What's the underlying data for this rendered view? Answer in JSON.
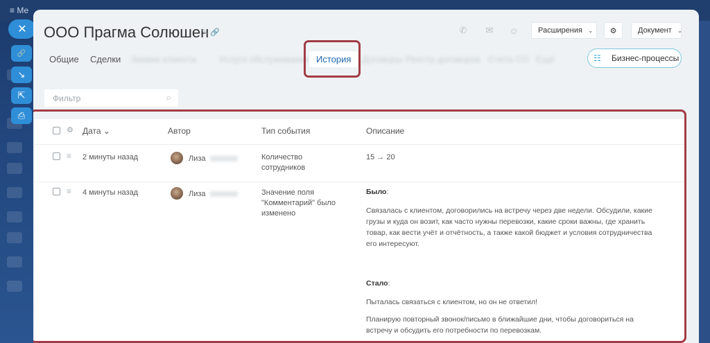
{
  "background": {
    "menu_label": "≡  Ме"
  },
  "quick_actions": [
    {
      "icon": "close-icon",
      "glyph": "✕"
    },
    {
      "icon": "link-icon",
      "glyph": "🔗"
    },
    {
      "icon": "arrow-icon",
      "glyph": "↘"
    },
    {
      "icon": "external-icon",
      "glyph": "⇱"
    },
    {
      "icon": "printer-icon",
      "glyph": "⎙"
    }
  ],
  "header": {
    "title": "ООО Прагма Солюшен",
    "title_icons": "✎ 🔗",
    "extensions_label": "Расширения",
    "document_label": "Документ",
    "call_glyph": "✆",
    "mail_glyph": "✉",
    "chat_glyph": "☺",
    "settings_glyph": "⚙",
    "chevron": "⌄"
  },
  "tabs": [
    {
      "label": "Общие"
    },
    {
      "label": "Сделки"
    },
    {
      "label": "Заявки клиента"
    },
    {
      "label": "Услуги обслуживания"
    },
    {
      "label": "История"
    },
    {
      "label": "Договоры"
    },
    {
      "label": "Реестр договоров"
    },
    {
      "label": "Счета СО"
    },
    {
      "label": "Ещё"
    }
  ],
  "business_processes": {
    "label": "Бизнес-процессы",
    "glyph": "☷"
  },
  "filter": {
    "placeholder": "Фильтр",
    "glyph": "⌕"
  },
  "grid": {
    "columns": [
      "Дата",
      "Автор",
      "Тип события",
      "Описание"
    ],
    "sort_glyph": "⌄",
    "gear_glyph": "⚙",
    "burger_glyph": "≡",
    "rows": [
      {
        "date": "2 минуты назад",
        "author": "Лиза",
        "event_type_lines": [
          "Количество",
          "сотрудников"
        ],
        "description": "15 → 20"
      },
      {
        "date": "4 минуты назад",
        "author": "Лиза",
        "event_type_lines": [
          "Значение поля",
          "\"Комментарий\" было",
          "изменено"
        ],
        "was_label": "Было",
        "was_lines": [
          "Связалась с клиентом, договорились на встречу через две недели. Обсудили, какие",
          "грузы и куда он возит, как часто нужны перевозки, какие сроки важны, где хранить",
          "товар, как вести учёт и отчётность, а также какой бюджет и условия сотрудничества",
          "его интересуют."
        ],
        "became_label": "Стало",
        "became_lines": [
          "Пыталась связаться с клиентом, но он не ответил!",
          "Планирую повторный звонок/письмо в ближайшие дни, чтобы договориться на",
          "встречу и обсудить его потребности по перевозкам."
        ]
      }
    ]
  },
  "colors": {
    "accent": "#2067b0",
    "highlight": "#a23c44",
    "quick_button": "#2f8ed8"
  }
}
